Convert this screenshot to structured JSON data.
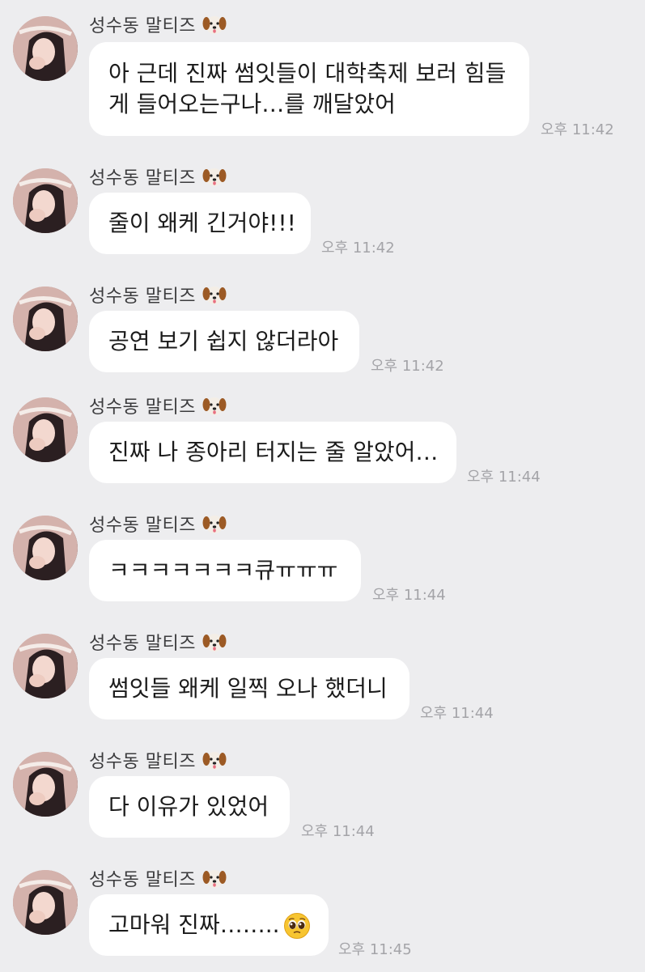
{
  "sender": {
    "name": "성수동 말티즈",
    "badge_icon": "dog-face-icon"
  },
  "messages": [
    {
      "text": "아 근데 진짜 썸잇들이 대학축제 보러 힘들게 들어오는구나…를 깨달았어",
      "lines": [
        "아 근데 진짜 썸잇들이 대학축제 보러 힘들",
        "게 들어오는구나…를 깨달았어"
      ],
      "time": "오후 11:42"
    },
    {
      "text": "줄이 왜케 긴거야!!!",
      "time": "오후 11:42"
    },
    {
      "text": "공연 보기 쉽지 않더라아",
      "time": "오후 11:42"
    },
    {
      "text": "진짜 나 종아리 터지는 줄 알았어…",
      "time": "오후 11:44"
    },
    {
      "text": "ㅋㅋㅋㅋㅋㅋㅋ큐ㅠㅠㅠ",
      "time": "오후 11:44"
    },
    {
      "text": "썸잇들 왜케 일찍 오나 했더니",
      "time": "오후 11:44"
    },
    {
      "text": "다 이유가 있었어",
      "time": "오후 11:44"
    },
    {
      "text": "고마워 진짜……..",
      "trailing_emoji": "pleading-face-icon",
      "time": "오후 11:45"
    }
  ]
}
